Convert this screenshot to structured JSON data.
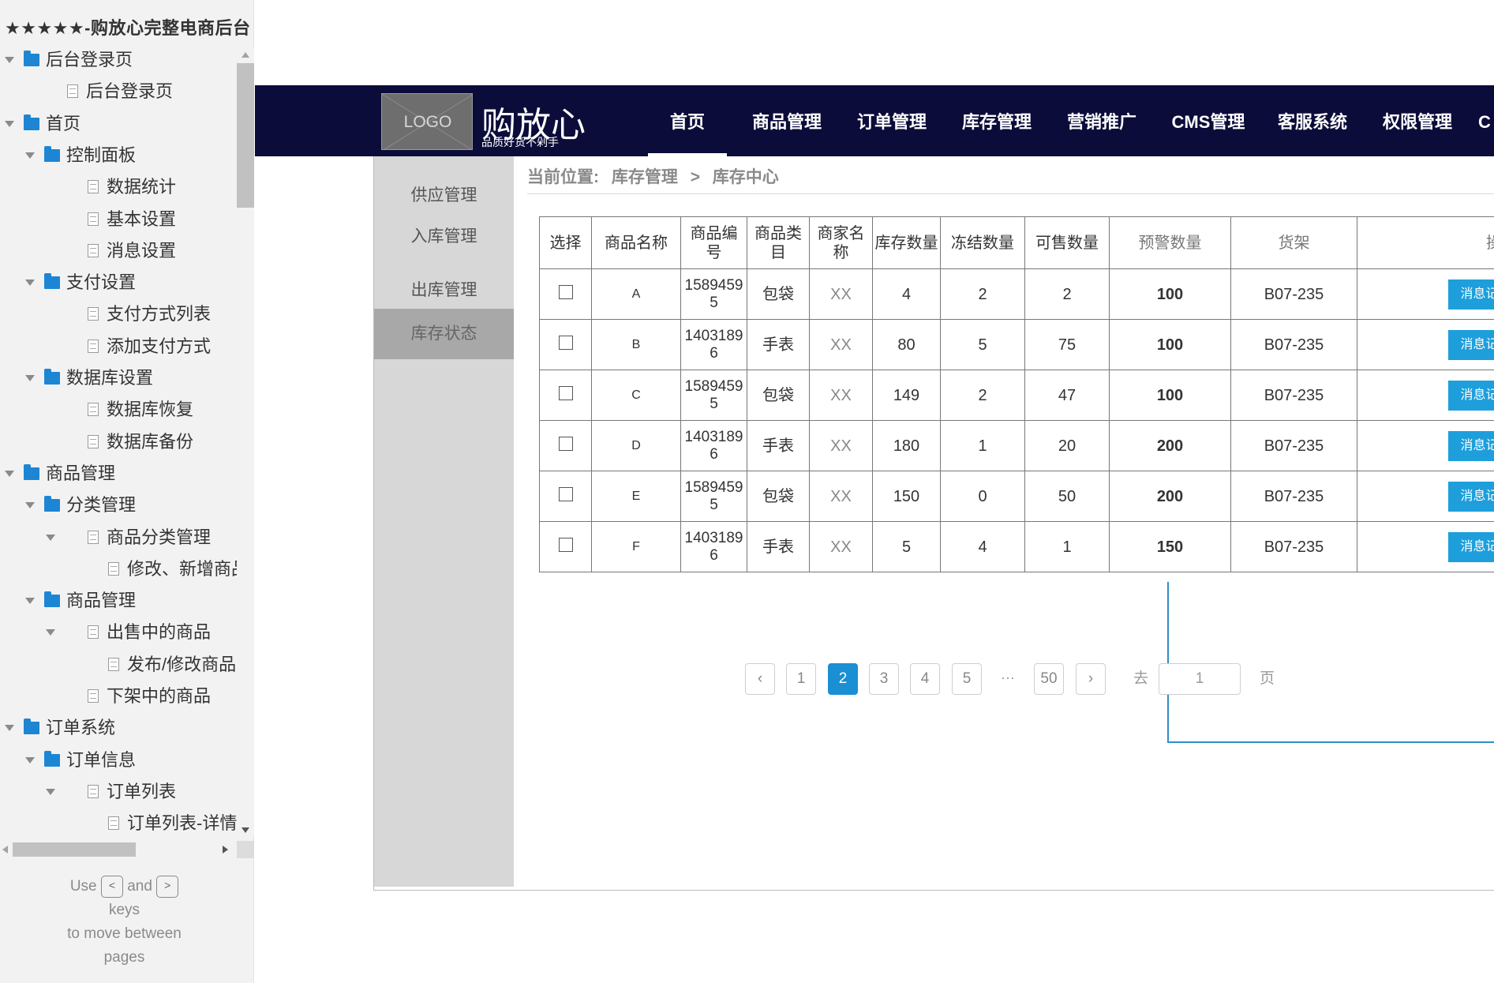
{
  "sitemap": {
    "title": "★★★★★-购放心完整电商后台",
    "items": [
      {
        "label": "后台登录页",
        "kind": "folder",
        "level": 0,
        "expanded": true
      },
      {
        "label": "后台登录页",
        "kind": "page",
        "level": 1
      },
      {
        "label": "首页",
        "kind": "folder",
        "level": 0,
        "expanded": true
      },
      {
        "label": "控制面板",
        "kind": "folder",
        "level": 1,
        "expanded": true
      },
      {
        "label": "数据统计",
        "kind": "page",
        "level": 2
      },
      {
        "label": "基本设置",
        "kind": "page",
        "level": 2
      },
      {
        "label": "消息设置",
        "kind": "page",
        "level": 2
      },
      {
        "label": "支付设置",
        "kind": "folder",
        "level": 1,
        "expanded": true
      },
      {
        "label": "支付方式列表",
        "kind": "page",
        "level": 2
      },
      {
        "label": "添加支付方式",
        "kind": "page",
        "level": 2
      },
      {
        "label": "数据库设置",
        "kind": "folder",
        "level": 1,
        "expanded": true
      },
      {
        "label": "数据库恢复",
        "kind": "page",
        "level": 2
      },
      {
        "label": "数据库备份",
        "kind": "page",
        "level": 2
      },
      {
        "label": "商品管理",
        "kind": "folder",
        "level": 0,
        "expanded": true
      },
      {
        "label": "分类管理",
        "kind": "folder",
        "level": 1,
        "expanded": true
      },
      {
        "label": "商品分类管理",
        "kind": "page",
        "level": 2,
        "expanded": true
      },
      {
        "label": "修改、新增商品分",
        "kind": "page",
        "level": 3
      },
      {
        "label": "商品管理",
        "kind": "folder",
        "level": 1,
        "expanded": true
      },
      {
        "label": "出售中的商品",
        "kind": "page",
        "level": 2,
        "expanded": true
      },
      {
        "label": "发布/修改商品",
        "kind": "page",
        "level": 3
      },
      {
        "label": "下架中的商品",
        "kind": "page",
        "level": 2
      },
      {
        "label": "订单系统",
        "kind": "folder",
        "level": 0,
        "expanded": true
      },
      {
        "label": "订单信息",
        "kind": "folder",
        "level": 1,
        "expanded": true
      },
      {
        "label": "订单列表",
        "kind": "page",
        "level": 2,
        "expanded": true
      },
      {
        "label": "订单列表-详情页",
        "kind": "page",
        "level": 3
      }
    ],
    "hint": {
      "use": "Use",
      "and": "and",
      "keys": "keys",
      "line2": "to move between",
      "line3": "pages",
      "key_prev": "<",
      "key_next": ">"
    }
  },
  "header": {
    "logo": "LOGO",
    "brand": "购放心",
    "slogan": "品质好货不剁手",
    "nav": [
      "首页",
      "商品管理",
      "订单管理",
      "库存管理",
      "营销推广",
      "CMS管理",
      "客服系统",
      "权限管理",
      "C"
    ],
    "active_nav": 0
  },
  "subnav": {
    "items": [
      "供应管理",
      "入库管理",
      "出库管理",
      "库存状态"
    ],
    "active": 3
  },
  "breadcrumb": {
    "prefix": "当前位置:",
    "level1": "库存管理",
    "sep": ">",
    "level2": "库存中心"
  },
  "table": {
    "headers": [
      "选择",
      "商品名称",
      "商品编号",
      "商品类目",
      "商家名称",
      "库存数量",
      "冻结数量",
      "可售数量",
      "预警数量",
      "货架",
      "操作"
    ],
    "button_label": "消息记录",
    "rows": [
      {
        "checked": false,
        "name": "A",
        "code": "15894595",
        "category": "包袋",
        "merchant": "XX",
        "stock": "4",
        "frozen": "2",
        "sellable": "2",
        "warning": "100",
        "shelf": "B07-235"
      },
      {
        "checked": false,
        "name": "B",
        "code": "14031896",
        "category": "手表",
        "merchant": "XX",
        "stock": "80",
        "frozen": "5",
        "sellable": "75",
        "warning": "100",
        "shelf": "B07-235"
      },
      {
        "checked": false,
        "name": "C",
        "code": "15894595",
        "category": "包袋",
        "merchant": "XX",
        "stock": "149",
        "frozen": "2",
        "sellable": "47",
        "warning": "100",
        "shelf": "B07-235"
      },
      {
        "checked": false,
        "name": "D",
        "code": "14031896",
        "category": "手表",
        "merchant": "XX",
        "stock": "180",
        "frozen": "1",
        "sellable": "20",
        "warning": "200",
        "shelf": "B07-235"
      },
      {
        "checked": false,
        "name": "E",
        "code": "15894595",
        "category": "包袋",
        "merchant": "XX",
        "stock": "150",
        "frozen": "0",
        "sellable": "50",
        "warning": "200",
        "shelf": "B07-235"
      },
      {
        "checked": false,
        "name": "F",
        "code": "14031896",
        "category": "手表",
        "merchant": "XX",
        "stock": "5",
        "frozen": "4",
        "sellable": "1",
        "warning": "150",
        "shelf": "B07-235"
      }
    ]
  },
  "pagination": {
    "prev": "‹",
    "next": "›",
    "pages": [
      "1",
      "2",
      "3",
      "4",
      "5"
    ],
    "current": "2",
    "ellipsis": "···",
    "last": "50",
    "goto_label": "去",
    "goto_value": "1",
    "page_suffix": "页"
  },
  "colors": {
    "topbar": "#0c0c3a",
    "accent": "#1e9fdc",
    "folder_icon": "#1d86d4",
    "subnav_bg": "#d7d7d7",
    "subnav_active": "#a8a8a8"
  }
}
